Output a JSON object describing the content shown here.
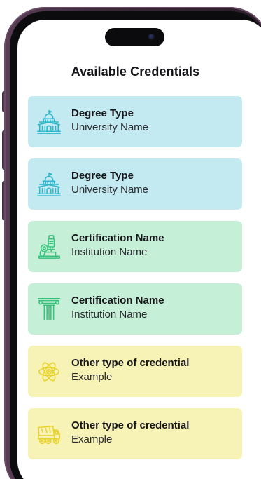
{
  "header": {
    "title": "Available Credentials"
  },
  "colors": {
    "degree_card_bg": "#c3eaf0",
    "degree_icon": "#2fb6cc",
    "certification_card_bg": "#c6efd8",
    "certification_icon": "#36c27a",
    "other_card_bg": "#f7f3b6",
    "other_icon": "#e8d22c",
    "phone_frame": "#3c2a3b"
  },
  "credentials": [
    {
      "title": "Degree Type",
      "subtitle": "University Name",
      "icon": "university-building-icon",
      "category": "degree"
    },
    {
      "title": "Degree Type",
      "subtitle": "University Name",
      "icon": "university-building-icon",
      "category": "degree"
    },
    {
      "title": "Certification Name",
      "subtitle": "Institution Name",
      "icon": "microscope-icon",
      "category": "certification"
    },
    {
      "title": "Certification Name",
      "subtitle": "Institution Name",
      "icon": "greek-column-icon",
      "category": "certification"
    },
    {
      "title": "Other type of credential",
      "subtitle": "Example",
      "icon": "atom-icon",
      "category": "other"
    },
    {
      "title": "Other type of credential",
      "subtitle": "Example",
      "icon": "dump-truck-icon",
      "category": "other"
    }
  ]
}
